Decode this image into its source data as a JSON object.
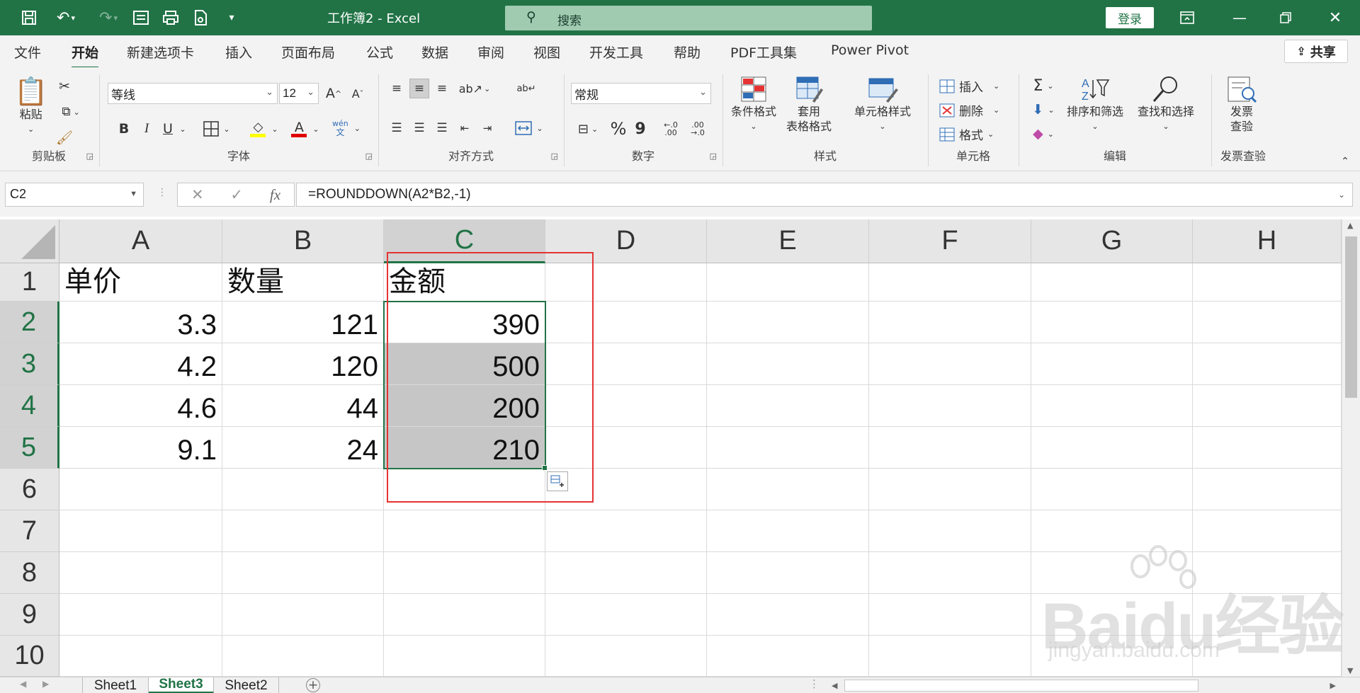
{
  "window": {
    "title": "工作簿2  -  Excel",
    "search_placeholder": "搜索",
    "login_label": "登录"
  },
  "tabs": [
    "文件",
    "开始",
    "新建选项卡",
    "插入",
    "页面布局",
    "公式",
    "数据",
    "审阅",
    "视图",
    "开发工具",
    "帮助",
    "PDF工具集",
    "Power Pivot"
  ],
  "active_tab": "开始",
  "share_label": "共享",
  "ribbon": {
    "clipboard": {
      "paste": "粘贴",
      "group": "剪贴板"
    },
    "font": {
      "name": "等线",
      "size": "12",
      "group": "字体",
      "bold": "B",
      "italic": "I",
      "underline": "U",
      "phonetic_top": "wén",
      "phonetic_bottom": "文"
    },
    "align": {
      "group": "对齐方式"
    },
    "number": {
      "format": "常规",
      "group": "数字",
      "percent": "%",
      "comma": "9"
    },
    "styles": {
      "conditional": "条件格式",
      "table_line1": "套用",
      "table_line2": "表格格式",
      "cell_styles": "单元格样式",
      "group": "样式"
    },
    "cells": {
      "insert": "插入",
      "delete": "删除",
      "format": "格式",
      "group": "单元格"
    },
    "editing": {
      "sort_filter": "排序和筛选",
      "find_select": "查找和选择",
      "group": "编辑"
    },
    "invoice": {
      "line1": "发票",
      "line2": "查验",
      "group": "发票查验"
    }
  },
  "formula_bar": {
    "name_box": "C2",
    "formula": "=ROUNDDOWN(A2*B2,-1)",
    "fx": "fx"
  },
  "grid": {
    "columns": [
      "A",
      "B",
      "C",
      "D",
      "E",
      "F",
      "G",
      "H"
    ],
    "selected_column": "C",
    "rows": [
      "1",
      "2",
      "3",
      "4",
      "5",
      "6",
      "7",
      "8",
      "9",
      "10"
    ],
    "selected_rows": [
      "2",
      "3",
      "4",
      "5"
    ],
    "cells": {
      "A1": "单价",
      "B1": "数量",
      "C1": "金额",
      "A2": "3.3",
      "B2": "121",
      "C2": "390",
      "A3": "4.2",
      "B3": "120",
      "C3": "500",
      "A4": "4.6",
      "B4": "44",
      "C4": "200",
      "A5": "9.1",
      "B5": "24",
      "C5": "210"
    },
    "active_cell": "C2",
    "selection": "C2:C5"
  },
  "sheets": [
    "Sheet1",
    "Sheet3",
    "Sheet2"
  ],
  "active_sheet": "Sheet3",
  "watermark": {
    "brand": "Baidu经验",
    "url": "jingyan.baidu.com"
  },
  "colors": {
    "excel_green": "#217346",
    "highlight_box": "#e53333",
    "selection_fill": "#c6c6c6"
  }
}
